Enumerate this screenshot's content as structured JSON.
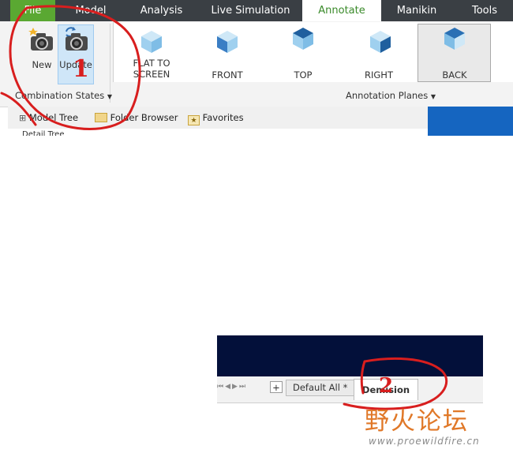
{
  "ribbon_tabs": [
    "File",
    "Model",
    "Analysis",
    "Live Simulation",
    "Annotate",
    "Manikin",
    "Tools"
  ],
  "combination_states": {
    "new_label": "New",
    "update_label": "Update",
    "group_label": "Combination States"
  },
  "annotation_planes": {
    "flat_line1": "FLAT TO",
    "flat_line2": "SCREEN",
    "front_label": "FRONT",
    "top_label": "TOP",
    "right_label": "RIGHT",
    "back_label": "BACK",
    "group_label": "Annotation Planes"
  },
  "navigator": {
    "model_tree": "Model Tree",
    "folder_browser": "Folder Browser",
    "favorites": "Favorites",
    "tree_item": "Detail Tree"
  },
  "sheet_bar": {
    "add_symbol": "+",
    "default_all": "Default All *",
    "demision": "Demision"
  },
  "annotations": {
    "marker1": "1",
    "marker2": "2"
  },
  "watermark": {
    "text": "野火论坛",
    "url": "www.proewildfire.cn"
  },
  "colors": {
    "file_tab": "#5aa832",
    "active_tab_text": "#3a8a2a",
    "red_markup": "#d81e1e",
    "watermark_orange": "#e07828"
  }
}
